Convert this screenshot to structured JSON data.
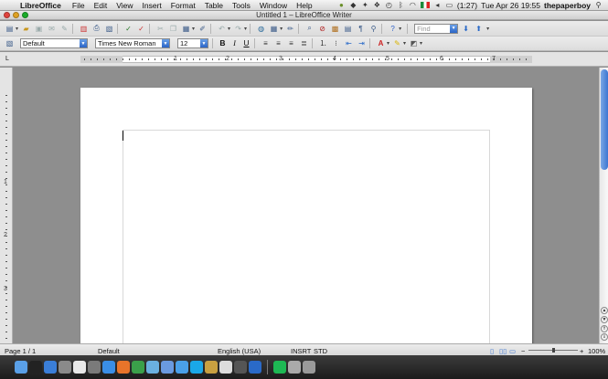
{
  "menubar": {
    "app_name": "LibreOffice",
    "items": [
      "File",
      "Edit",
      "View",
      "Insert",
      "Format",
      "Table",
      "Tools",
      "Window",
      "Help"
    ],
    "battery": "(1:27)",
    "clock": "Tue Apr 26  19:55",
    "user": "thepaperboy"
  },
  "window": {
    "title": "Untitled 1 – LibreOffice Writer"
  },
  "toolbar": {
    "find_placeholder": "Find"
  },
  "formatting": {
    "paragraph_style": "Default",
    "font_name": "Times New Roman",
    "font_size": "12",
    "bold": "B",
    "italic": "I",
    "underline": "U"
  },
  "ruler": {
    "numbers": [
      "1",
      "2",
      "3",
      "4",
      "5",
      "6",
      "7"
    ],
    "vertical_numbers": [
      "1",
      "2",
      "3"
    ]
  },
  "statusbar": {
    "page": "Page 1 / 1",
    "style": "Default",
    "language": "English (USA)",
    "insert_mode": "INSRT",
    "selection_mode": "STD",
    "zoom": "100%",
    "zoom_level": 1.0
  },
  "colors": {
    "accent": "#3c76d1",
    "page": "#ffffff",
    "background": "#8e8e8e"
  },
  "dock": {
    "icons": [
      "finder-icon",
      "terminal-icon",
      "app-store-icon",
      "preview-icon",
      "calendar-icon",
      "system-prefs-icon",
      "safari-icon",
      "firefox-icon",
      "chrome-icon",
      "itunes-icon",
      "mail-icon",
      "ichat-icon",
      "skype-icon",
      "photos-icon",
      "textedit-icon",
      "dictionary-icon",
      "libreoffice-icon",
      "spotify-icon",
      "misc-icon",
      "trash-icon"
    ]
  }
}
